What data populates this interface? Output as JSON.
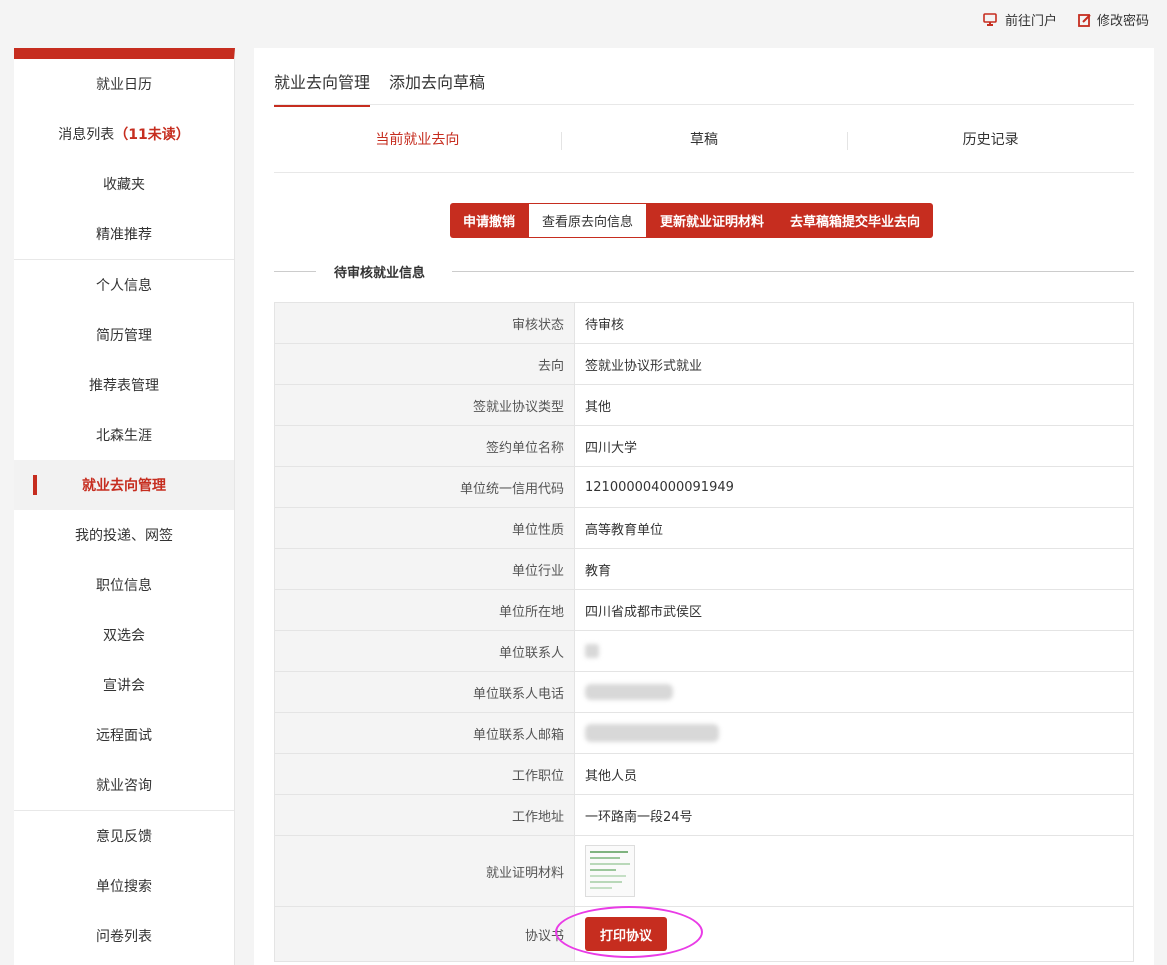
{
  "topbar": {
    "portal_label": "前往门户",
    "password_label": "修改密码"
  },
  "sidebar": {
    "items": [
      {
        "label": "就业日历"
      },
      {
        "label": "消息列表",
        "badge": "（11未读）"
      },
      {
        "label": "收藏夹"
      },
      {
        "label": "精准推荐"
      },
      {
        "label": "个人信息"
      },
      {
        "label": "简历管理"
      },
      {
        "label": "推荐表管理"
      },
      {
        "label": "北森生涯"
      },
      {
        "label": "就业去向管理"
      },
      {
        "label": "我的投递、网签"
      },
      {
        "label": "职位信息"
      },
      {
        "label": "双选会"
      },
      {
        "label": "宣讲会"
      },
      {
        "label": "远程面试"
      },
      {
        "label": "就业咨询"
      },
      {
        "label": "意见反馈"
      },
      {
        "label": "单位搜索"
      },
      {
        "label": "问卷列表"
      }
    ],
    "active_index": 8
  },
  "main": {
    "tabs": [
      {
        "label": "就业去向管理"
      },
      {
        "label": "添加去向草稿"
      }
    ],
    "subtabs": [
      {
        "label": "当前就业去向"
      },
      {
        "label": "草稿"
      },
      {
        "label": "历史记录"
      }
    ],
    "actions": [
      {
        "label": "申请撤销"
      },
      {
        "label": "查看原去向信息"
      },
      {
        "label": "更新就业证明材料"
      },
      {
        "label": "去草稿箱提交毕业去向"
      }
    ],
    "section_title": "待审核就业信息",
    "fields": [
      {
        "key": "审核状态",
        "value": "待审核"
      },
      {
        "key": "去向",
        "value": "签就业协议形式就业"
      },
      {
        "key": "签就业协议类型",
        "value": "其他"
      },
      {
        "key": "签约单位名称",
        "value": "四川大学"
      },
      {
        "key": "单位统一信用代码",
        "value": "121000004000091949"
      },
      {
        "key": "单位性质",
        "value": "高等教育单位"
      },
      {
        "key": "单位行业",
        "value": "教育"
      },
      {
        "key": "单位所在地",
        "value": "四川省成都市武侯区"
      },
      {
        "key": "单位联系人",
        "value": ""
      },
      {
        "key": "单位联系人电话",
        "value": ""
      },
      {
        "key": "单位联系人邮箱",
        "value": ""
      },
      {
        "key": "工作职位",
        "value": "其他人员"
      },
      {
        "key": "工作地址",
        "value": "一环路南一段24号"
      },
      {
        "key": "就业证明材料",
        "value": ""
      },
      {
        "key": "协议书",
        "value": ""
      }
    ],
    "print_button": "打印协议"
  },
  "colors": {
    "accent": "#c62d1f",
    "highlight_circle": "#e93be6"
  }
}
